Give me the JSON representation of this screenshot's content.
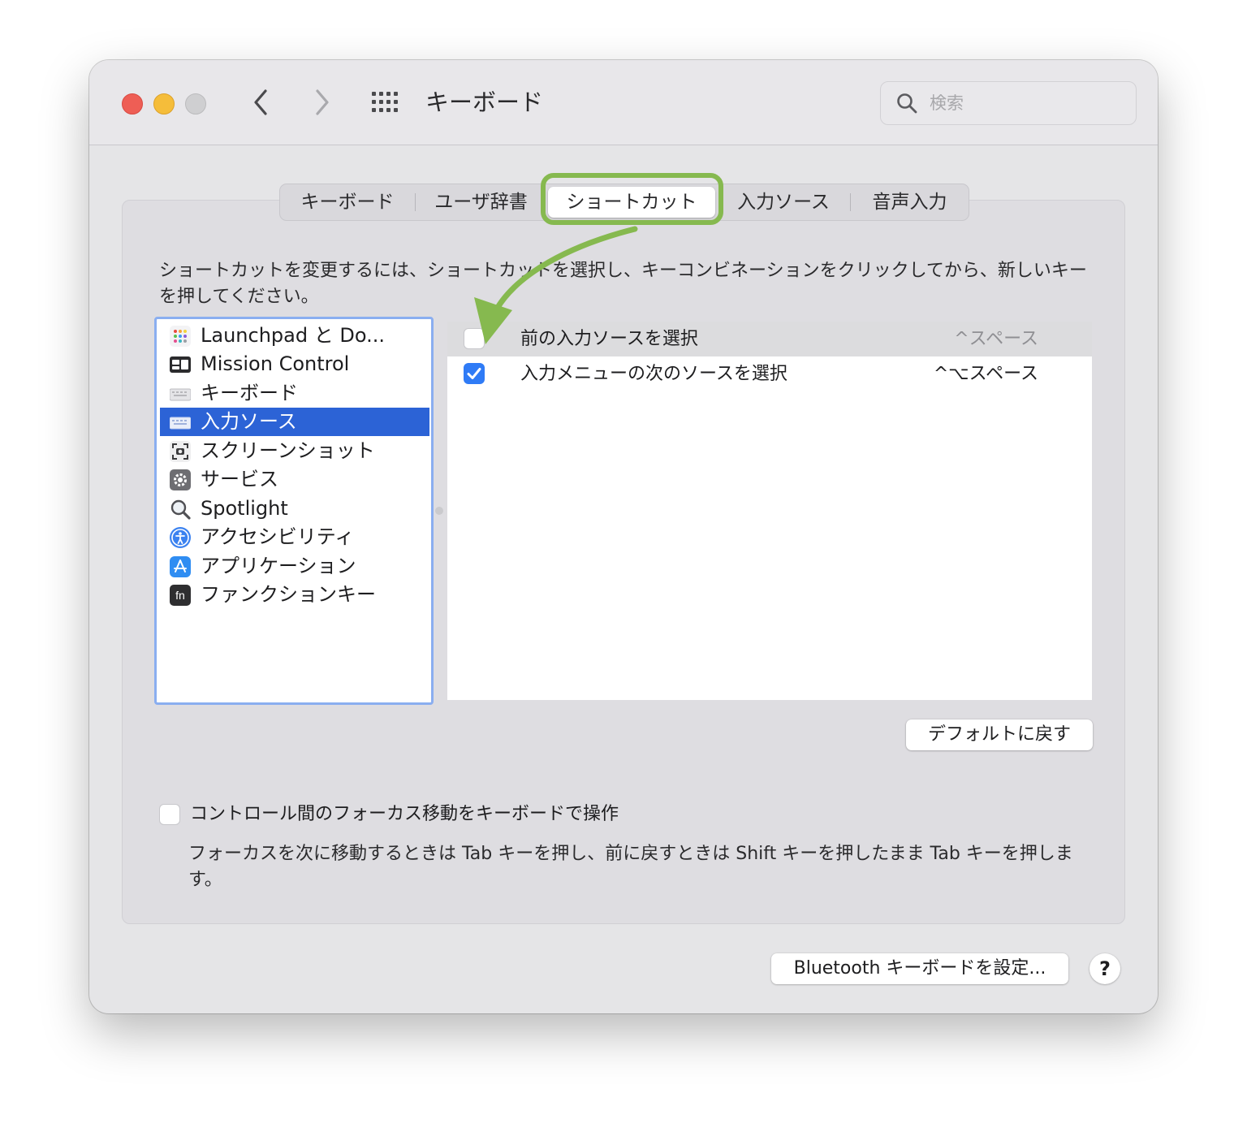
{
  "window": {
    "title": "キーボード",
    "search_placeholder": "検索"
  },
  "tabs": [
    {
      "label": "キーボード",
      "active": false
    },
    {
      "label": "ユーザ辞書",
      "active": false
    },
    {
      "label": "ショートカット",
      "active": true
    },
    {
      "label": "入力ソース",
      "active": false
    },
    {
      "label": "音声入力",
      "active": false
    }
  ],
  "instructions": "ショートカットを変更するには、ショートカットを選択し、キーコンビネーションをクリックしてから、新しいキーを押してください。",
  "categories": [
    {
      "label": "Launchpad と Do...",
      "icon": "launchpad-icon"
    },
    {
      "label": "Mission Control",
      "icon": "mission-control-icon"
    },
    {
      "label": "キーボード",
      "icon": "keyboard-icon"
    },
    {
      "label": "入力ソース",
      "icon": "input-source-keyboard-icon",
      "selected": true
    },
    {
      "label": "スクリーンショット",
      "icon": "screenshot-icon"
    },
    {
      "label": "サービス",
      "icon": "gear-icon"
    },
    {
      "label": "Spotlight",
      "icon": "magnifier-icon"
    },
    {
      "label": "アクセシビリティ",
      "icon": "accessibility-icon"
    },
    {
      "label": "アプリケーション",
      "icon": "app-store-icon"
    },
    {
      "label": "ファンクションキー",
      "icon": "fn-key-icon"
    }
  ],
  "shortcuts": [
    {
      "label": "前の入力ソースを選択",
      "key": "^スペース",
      "checked": false
    },
    {
      "label": "入力メニューの次のソースを選択",
      "key": "^⌥スペース",
      "checked": true
    }
  ],
  "buttons": {
    "restore_defaults": "デフォルトに戻す",
    "bluetooth": "Bluetooth キーボードを設定...",
    "help": "?"
  },
  "focus_option": {
    "label": "コントロール間のフォーカス移動をキーボードで操作",
    "checked": false,
    "description": "フォーカスを次に移動するときは Tab キーを押し、前に戻すときは Shift キーを押したまま Tab キーを押します。"
  },
  "colors": {
    "selection": "#2c63d6",
    "checkbox_on": "#2f7bf6",
    "annotation_green": "#86b94f",
    "list_focus_ring": "#8aaef0"
  }
}
